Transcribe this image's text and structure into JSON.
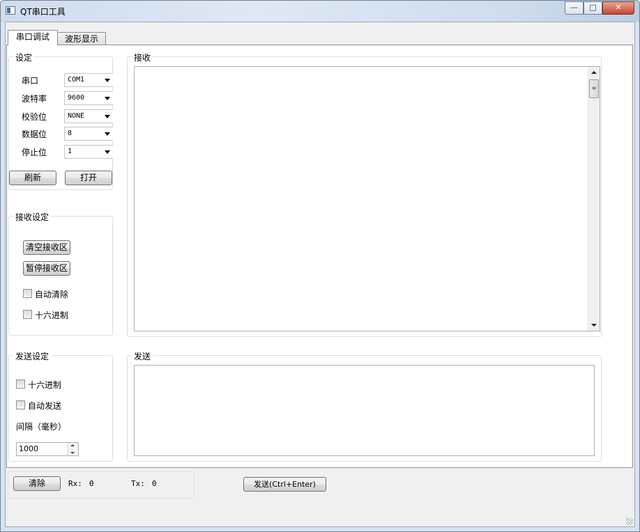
{
  "window": {
    "title": "QT串口工具",
    "controls": {
      "minimize": "—",
      "maximize": "□",
      "close": "✕"
    }
  },
  "tabs": [
    {
      "label": "串口调试",
      "active": true
    },
    {
      "label": "波形显示",
      "active": false
    }
  ],
  "settings": {
    "title": "设定",
    "fields": [
      {
        "label": "串口",
        "value": "COM1"
      },
      {
        "label": "波特率",
        "value": "9600"
      },
      {
        "label": "校验位",
        "value": "NONE"
      },
      {
        "label": "数据位",
        "value": "8"
      },
      {
        "label": "停止位",
        "value": "1"
      }
    ],
    "refresh_label": "刷新",
    "open_label": "打开"
  },
  "receive_settings": {
    "title": "接收设定",
    "clear_label": "清空接收区",
    "pause_label": "暂停接收区",
    "auto_clear_label": "自动清除",
    "hex_label": "十六进制"
  },
  "send_settings": {
    "title": "发送设定",
    "hex_label": "十六进制",
    "auto_send_label": "自动发送",
    "interval_label": "间隔（毫秒）",
    "interval_value": "1000"
  },
  "receive": {
    "title": "接收",
    "text": ""
  },
  "send": {
    "title": "发送",
    "text": ""
  },
  "footer": {
    "clear_label": "清除",
    "rx_label": "Rx:",
    "rx_value": "0",
    "tx_label": "Tx:",
    "tx_value": "0",
    "send_button_label": "发送(Ctrl+Enter)"
  },
  "icons": [
    "app-icon",
    "minimize-icon",
    "maximize-icon",
    "close-icon",
    "chevron-down-icon",
    "scroll-up-icon",
    "scroll-down-icon",
    "spin-up-icon",
    "spin-down-icon",
    "resize-grip-icon"
  ]
}
